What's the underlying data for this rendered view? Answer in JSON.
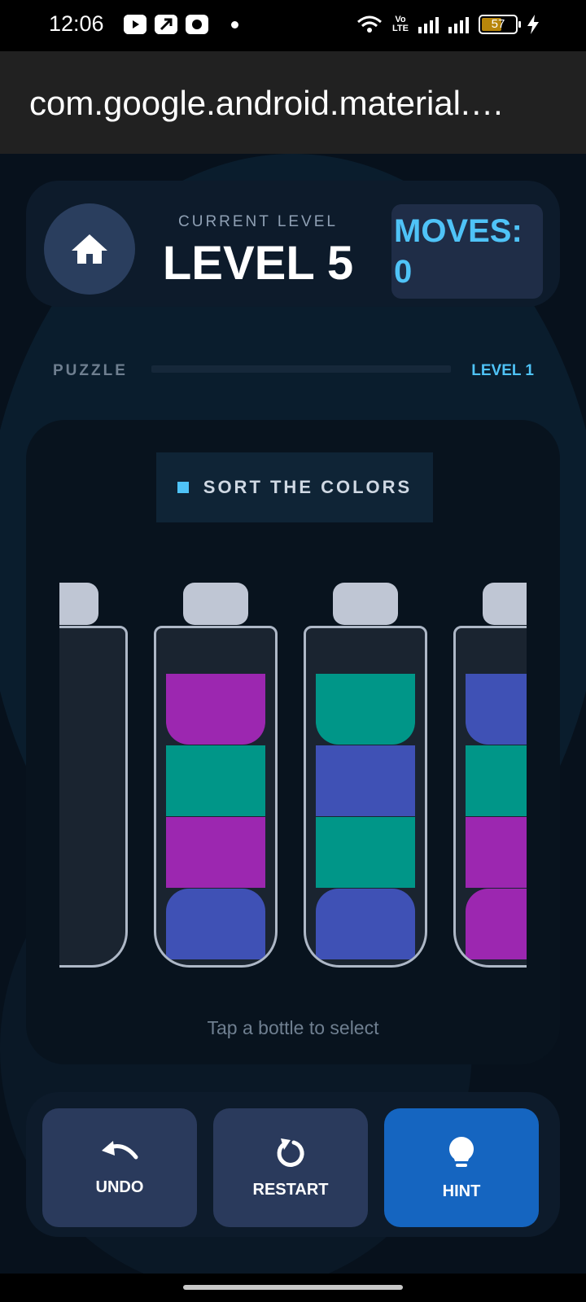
{
  "status_bar": {
    "time": "12:06",
    "volte": "Vo\nLTE",
    "battery": "57"
  },
  "app": {
    "title": "com.google.android.material.…"
  },
  "header": {
    "level_caption": "CURRENT LEVEL",
    "level_title": "LEVEL 5",
    "moves_label": "MOVES: 0"
  },
  "progress": {
    "left_label": "PUZZLE",
    "right_label": "LEVEL 1",
    "fill": 0
  },
  "game": {
    "badge": "SORT THE COLORS",
    "tap_hint": "Tap a bottle to select",
    "colors": {
      "purple": "#9c27b0",
      "teal": "#009688",
      "indigo": "#3f51b5"
    },
    "bottles": [
      {
        "segments": []
      },
      {
        "segments": [
          "purple",
          "teal",
          "purple",
          "indigo"
        ]
      },
      {
        "segments": [
          "teal",
          "indigo",
          "teal",
          "indigo"
        ]
      },
      {
        "segments": [
          "indigo",
          "teal",
          "purple",
          "purple"
        ]
      }
    ]
  },
  "controls": {
    "undo": "UNDO",
    "restart": "RESTART",
    "hint": "HINT"
  },
  "icons": [
    "home-icon",
    "undo-icon",
    "restart-icon",
    "lightbulb-icon",
    "wifi-icon",
    "signal-icon",
    "battery-icon",
    "charging-icon"
  ]
}
